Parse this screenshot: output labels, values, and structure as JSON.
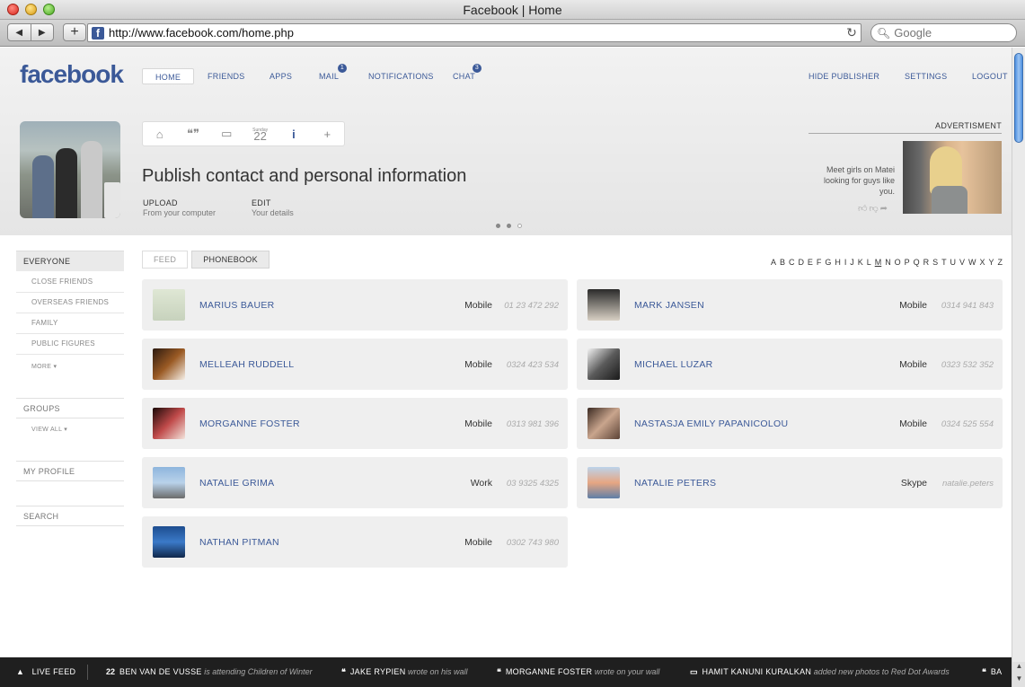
{
  "window": {
    "title": "Facebook | Home"
  },
  "browser": {
    "url": "http://www.facebook.com/home.php",
    "search_placeholder": "Google",
    "favicon": "f"
  },
  "header": {
    "logo": "facebook",
    "nav": [
      {
        "label": "HOME",
        "active": true
      },
      {
        "label": "FRIENDS"
      },
      {
        "label": "APPS"
      },
      {
        "label": "MAIL",
        "badge": "1"
      },
      {
        "label": "NOTIFICATIONS"
      },
      {
        "label": "CHAT",
        "badge": "3"
      }
    ],
    "right_links": {
      "hide_publisher": "HIDE PUBLISHER",
      "settings": "SETTINGS",
      "logout": "LOGOUT"
    }
  },
  "publisher": {
    "icons": [
      "home-icon",
      "quote-icon",
      "photo-icon",
      "calendar-icon",
      "info-icon",
      "plus-icon"
    ],
    "calendar_day": "22",
    "calendar_label": "Sunday",
    "title": "Publish contact and personal information",
    "actions": [
      {
        "label": "UPLOAD",
        "sub": "From your computer"
      },
      {
        "label": "EDIT",
        "sub": "Your details"
      }
    ]
  },
  "ad": {
    "label": "ADVERTISMENT",
    "text": "Meet girls on Matei looking for guys like you."
  },
  "sidebar": {
    "everyone": "EVERYONE",
    "lists": [
      "CLOSE FRIENDS",
      "OVERSEAS FRIENDS",
      "FAMILY",
      "PUBLIC FIGURES"
    ],
    "more": "MORE ▾",
    "groups": "GROUPS",
    "view_all": "VIEW ALL ▾",
    "my_profile": "MY PROFILE",
    "search": "SEARCH"
  },
  "tabs": {
    "feed": "FEED",
    "phonebook": "PHONEBOOK"
  },
  "alphabet": [
    "A",
    "B",
    "C",
    "D",
    "E",
    "F",
    "G",
    "H",
    "I",
    "J",
    "K",
    "L",
    "M",
    "N",
    "O",
    "P",
    "Q",
    "R",
    "S",
    "T",
    "U",
    "V",
    "W",
    "X",
    "Y",
    "Z"
  ],
  "contacts": [
    {
      "name": "MARIUS BAUER",
      "type": "Mobile",
      "value": "01 23 472 292"
    },
    {
      "name": "MARK JANSEN",
      "type": "Mobile",
      "value": "0314 941 843"
    },
    {
      "name": "MELLEAH RUDDELL",
      "type": "Mobile",
      "value": "0324 423 534"
    },
    {
      "name": "MICHAEL LUZAR",
      "type": "Mobile",
      "value": "0323 532 352"
    },
    {
      "name": "MORGANNE FOSTER",
      "type": "Mobile",
      "value": "0313 981 396"
    },
    {
      "name": "NASTASJA EMILY PAPANICOLOU",
      "type": "Mobile",
      "value": "0324 525 554"
    },
    {
      "name": "NATALIE GRIMA",
      "type": "Work",
      "value": "03 9325 4325"
    },
    {
      "name": "NATALIE PETERS",
      "type": "Skype",
      "value": "natalie.peters"
    },
    {
      "name": "NATHAN PITMAN",
      "type": "Mobile",
      "value": "0302 743 980"
    }
  ],
  "livefeed": {
    "label": "LIVE FEED",
    "items": [
      {
        "icon": "22",
        "name": "BEN VAN DE VUSSE",
        "action": "is attending Children of Winter"
      },
      {
        "icon": "❝",
        "name": "JAKE RYPIEN",
        "action": "wrote on his wall"
      },
      {
        "icon": "❝",
        "name": "MORGANNE FOSTER",
        "action": "wrote on your wall"
      },
      {
        "icon": "▭",
        "name": "HAMIT KANUNI KURALKAN",
        "action": "added new photos to Red Dot Awards"
      },
      {
        "icon": "❝",
        "name": "BA",
        "action": ""
      }
    ]
  },
  "colors": {
    "brand": "#3b5998",
    "feed_bg": "#1f1f1f",
    "card_bg": "#efefef"
  }
}
